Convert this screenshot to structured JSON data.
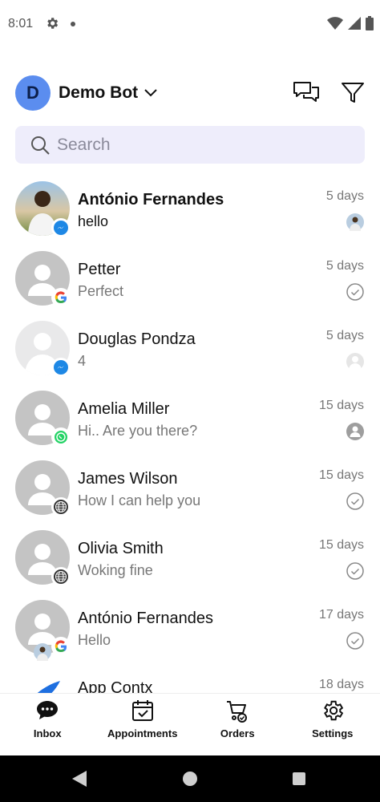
{
  "status_bar": {
    "time": "8:01"
  },
  "header": {
    "org_initial": "D",
    "org_name": "Demo Bot",
    "colors": {
      "avatar": "#5b8def"
    }
  },
  "search": {
    "placeholder": "Search"
  },
  "conversations": [
    {
      "name": "António Fernandes",
      "preview": "hello",
      "time": "5 days",
      "channel": "messenger-icon",
      "unread": true,
      "status": "agent-avatar"
    },
    {
      "name": "Petter",
      "preview": "Perfect",
      "time": "5 days",
      "channel": "google-icon",
      "unread": false,
      "status": "check-circle-icon"
    },
    {
      "name": "Douglas Pondza",
      "preview": "4",
      "time": "5 days",
      "channel": "messenger-icon",
      "unread": false,
      "status": "profile-placeholder"
    },
    {
      "name": "Amelia Miller",
      "preview": "Hi.. Are you there?",
      "time": "15 days",
      "channel": "whatsapp-icon",
      "unread": false,
      "status": "person-circle-icon"
    },
    {
      "name": "James Wilson",
      "preview": "How I can help you",
      "time": "15 days",
      "channel": "globe-icon",
      "unread": false,
      "status": "check-circle-icon"
    },
    {
      "name": "Olivia Smith",
      "preview": "Woking fine",
      "time": "15 days",
      "channel": "globe-icon",
      "unread": false,
      "status": "check-circle-icon"
    },
    {
      "name": "António Fernandes",
      "preview": "Hello",
      "time": "17 days",
      "channel": "google-icon",
      "unread": false,
      "status": "check-circle-icon"
    },
    {
      "name": "App Contx",
      "preview": "",
      "time": "18 days",
      "channel": "",
      "unread": false,
      "status": ""
    }
  ],
  "bottom_nav": {
    "inbox": "Inbox",
    "appointments": "Appointments",
    "orders": "Orders",
    "settings": "Settings"
  }
}
